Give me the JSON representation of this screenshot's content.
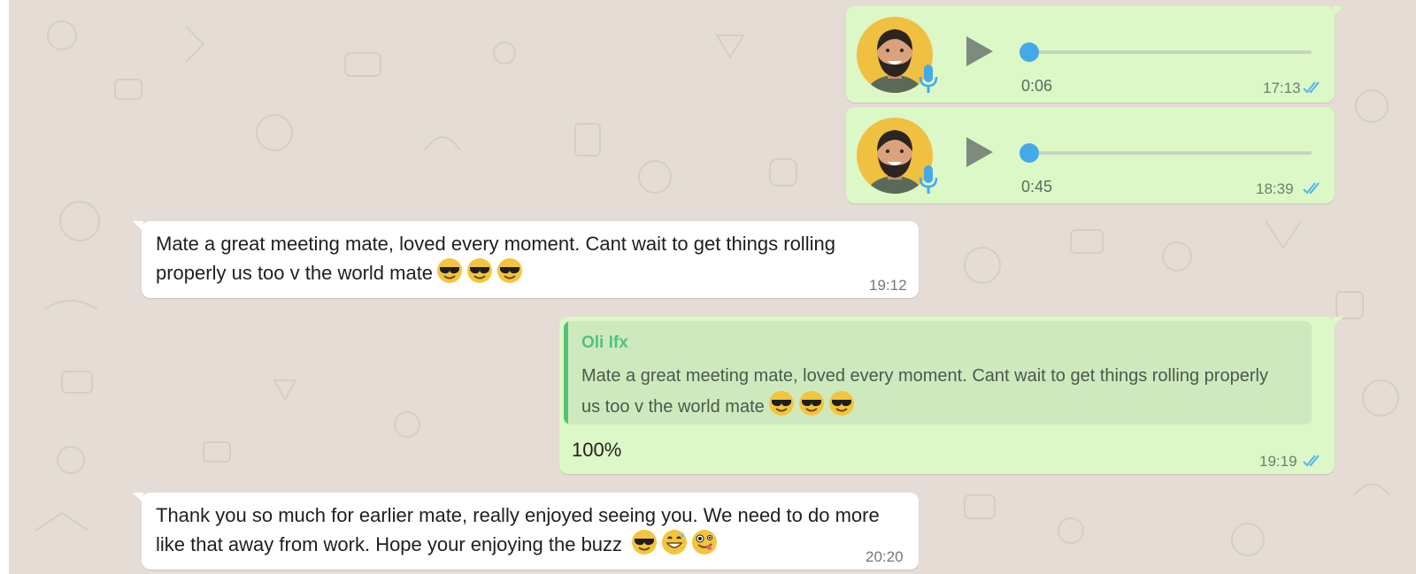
{
  "colors": {
    "wallpaper": "#e5ddd5",
    "outgoing_bubble": "#dcf8c6",
    "incoming_bubble": "#ffffff",
    "read_ticks": "#4fb6ec",
    "quote_accent": "#53c27a",
    "voice_knob": "#45a8e8"
  },
  "voice_messages": [
    {
      "duration": "0:06",
      "time": "17:13",
      "status_icon": "double-check-read-icon",
      "progress": 0
    },
    {
      "duration": "0:45",
      "time": "18:39",
      "status_icon": "double-check-read-icon",
      "progress": 0
    }
  ],
  "messages": [
    {
      "direction": "incoming",
      "lines": [
        "Mate a great meeting mate, loved every moment. Cant wait to get things rolling",
        "properly us too v the  world  mate"
      ],
      "emojis": [
        "smiling-face-with-sunglasses",
        "smiling-face-with-sunglasses",
        "smiling-face-with-sunglasses"
      ],
      "time": "19:12"
    },
    {
      "direction": "outgoing",
      "quoted": {
        "author": "Oli Ifx",
        "lines": [
          "Mate a great meeting mate, loved every moment. Cant wait to get things rolling properly",
          "us too v the  world  mate"
        ],
        "emojis": [
          "smiling-face-with-sunglasses",
          "smiling-face-with-sunglasses",
          "smiling-face-with-sunglasses"
        ]
      },
      "text": "100%",
      "time": "19:19",
      "status_icon": "double-check-read-icon"
    },
    {
      "direction": "incoming",
      "lines": [
        "Thank you so much for earlier mate, really enjoyed seeing you. We need to do more",
        "like that away from work. Hope your enjoying the buzz"
      ],
      "emojis": [
        "smiling-face-with-sunglasses",
        "grinning-face-with-sweat",
        "zany-face"
      ],
      "time": "20:20"
    }
  ]
}
